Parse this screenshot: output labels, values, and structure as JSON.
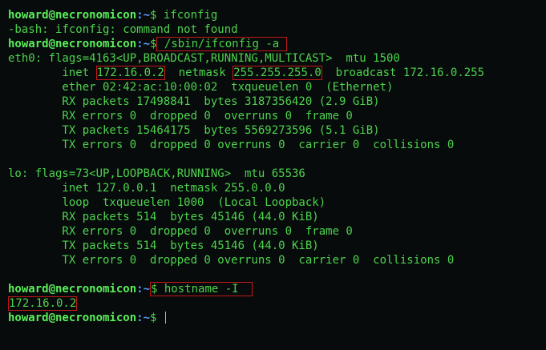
{
  "colors": {
    "background": "#070b0b",
    "text": "#4dd34d",
    "prompt_user": "#5af05a",
    "prompt_path": "#5a9bff",
    "highlight_box": "#c41818"
  },
  "prompt": {
    "user_host": "howard@necronomicon",
    "path": ":~",
    "symbol": "$ "
  },
  "session": {
    "cmd1": "ifconfig",
    "err1": "-bash: ifconfig: command not found",
    "cmd2_pre": "",
    "cmd2": "/sbin/ifconfig -a",
    "eth0": {
      "flags": "eth0: flags=4163<UP,BROADCAST,RUNNING,MULTICAST>  mtu 1500",
      "inet_label": "        inet ",
      "inet_ip": "172.16.0.2",
      "netmask_label": "  netmask ",
      "netmask": "255.255.255.0",
      "broadcast": "  broadcast 172.16.0.255",
      "ether": "        ether 02:42:ac:10:00:02  txqueuelen 0  (Ethernet)",
      "rx_packets": "        RX packets 17498841  bytes 3187356420 (2.9 GiB)",
      "rx_errors": "        RX errors 0  dropped 0  overruns 0  frame 0",
      "tx_packets": "        TX packets 15464175  bytes 5569273596 (5.1 GiB)",
      "tx_errors": "        TX errors 0  dropped 0 overruns 0  carrier 0  collisions 0"
    },
    "lo": {
      "flags": "lo: flags=73<UP,LOOPBACK,RUNNING>  mtu 65536",
      "inet": "        inet 127.0.0.1  netmask 255.0.0.0",
      "loop": "        loop  txqueuelen 1000  (Local Loopback)",
      "rx_packets": "        RX packets 514  bytes 45146 (44.0 KiB)",
      "rx_errors": "        RX errors 0  dropped 0  overruns 0  frame 0",
      "tx_packets": "        TX packets 514  bytes 45146 (44.0 KiB)",
      "tx_errors": "        TX errors 0  dropped 0 overruns 0  carrier 0  collisions 0"
    },
    "cmd3": "hostname -I",
    "hostname_output": "172.16.0.2"
  }
}
